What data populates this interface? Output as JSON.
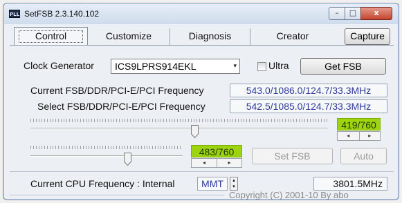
{
  "window": {
    "title": "SetFSB 2.3.140.102",
    "icon_text": "PLL",
    "controls": {
      "minimize": "–",
      "maximize": "□",
      "close": "x"
    }
  },
  "tabs": [
    {
      "label": "Control",
      "active": true
    },
    {
      "label": "Customize",
      "active": false
    },
    {
      "label": "Diagnosis",
      "active": false
    },
    {
      "label": "Creator",
      "active": false
    }
  ],
  "capture_button": "Capture",
  "clock": {
    "label": "Clock Generator",
    "selected": "ICS9LPRS914EKL",
    "ultra_label": "Ultra",
    "ultra_checked": false,
    "get_fsb_button": "Get FSB"
  },
  "frequencies": {
    "current_label": "Current FSB/DDR/PCI-E/PCI Frequency",
    "current_value": "543.0/1086.0/124.7/33.3MHz",
    "select_label": "Select FSB/DDR/PCI-E/PCI Frequency",
    "select_value": "542.5/1085.0/124.7/33.3MHz"
  },
  "slider_top": {
    "value": 419,
    "max": 760,
    "display": "419/760"
  },
  "slider_bottom": {
    "value": 483,
    "max": 760,
    "display": "483/760"
  },
  "spin_glyphs": {
    "left": "◂",
    "right": "▸",
    "up": "▴",
    "down": "▾"
  },
  "buttons": {
    "set_fsb": "Set FSB",
    "auto": "Auto"
  },
  "cpu": {
    "label": "Current CPU Frequency : Internal",
    "source": "MMT",
    "value": "3801.5MHz"
  },
  "copyright": "Copyright (C) 2001-10 By abo",
  "colors": {
    "value_green": "#9ed40f",
    "readout_blue": "#2d3a9c",
    "close_red": "#c4442d"
  }
}
